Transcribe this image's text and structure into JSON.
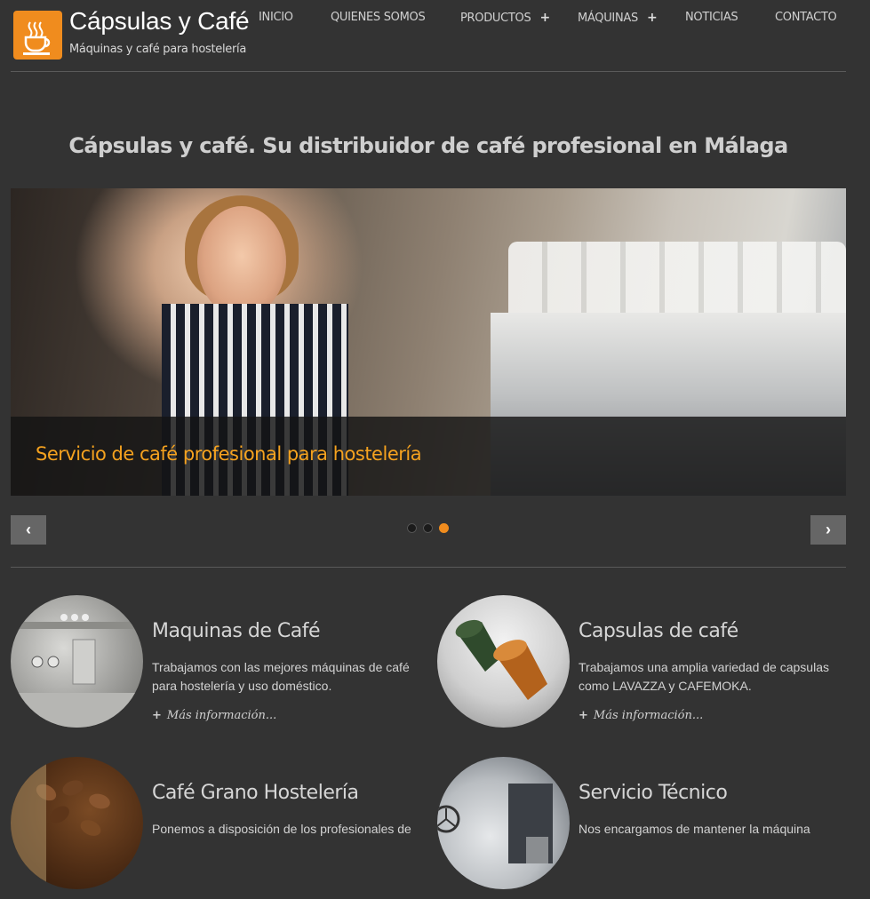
{
  "header": {
    "site_title": "Cápsulas y Café",
    "tagline": "Máquinas y café para hostelería",
    "brand_color": "#f08c1e"
  },
  "nav": {
    "items": [
      {
        "label": "INICIO",
        "has_submenu": false
      },
      {
        "label": "QUIENES SOMOS",
        "has_submenu": false
      },
      {
        "label": "PRODUCTOS",
        "has_submenu": true
      },
      {
        "label": "MÁQUINAS",
        "has_submenu": true
      },
      {
        "label": "NOTICIAS",
        "has_submenu": false
      },
      {
        "label": "CONTACTO",
        "has_submenu": false
      }
    ],
    "submenu_symbol": "+"
  },
  "main": {
    "heading": "Cápsulas y café. Su distribuidor de café profesional en Málaga"
  },
  "slider": {
    "caption": "Servicio de café profesional para hostelería",
    "caption_color": "#f5a21f",
    "prev_icon": "‹",
    "next_icon": "›",
    "slide_count": 3,
    "active_slide": 3
  },
  "features": [
    {
      "title": "Maquinas de Café",
      "description": "Trabajamos con las mejores máquinas de café para hostelería y uso doméstico.",
      "more": "Más información..."
    },
    {
      "title": "Capsulas de café",
      "description": "Trabajamos una amplia variedad de capsulas como LAVAZZA y CAFEMOKA.",
      "more": "Más información..."
    },
    {
      "title": "Café Grano Hostelería",
      "description": "Ponemos a disposición de los profesionales de",
      "more": ""
    },
    {
      "title": "Servicio Técnico",
      "description": "Nos encargamos de mantener la máquina",
      "more": ""
    }
  ],
  "more_symbol": "+"
}
